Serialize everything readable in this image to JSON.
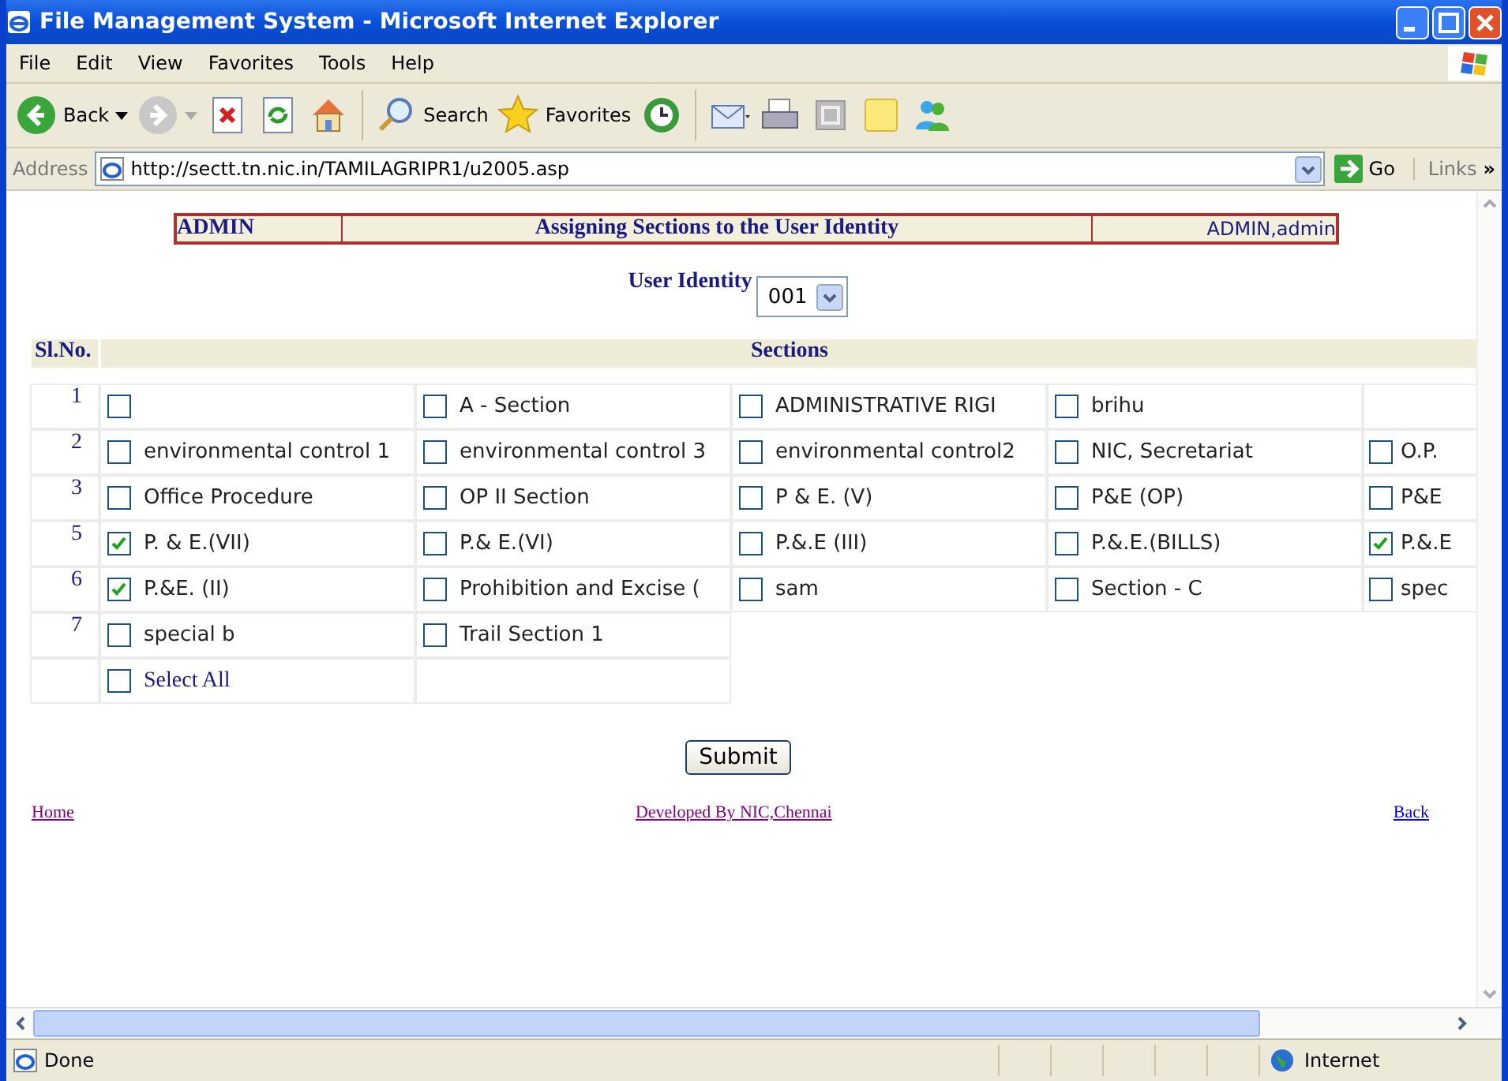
{
  "window": {
    "title": "File Management System - Microsoft Internet Explorer"
  },
  "menu": [
    "File",
    "Edit",
    "View",
    "Favorites",
    "Tools",
    "Help"
  ],
  "toolbar": [
    {
      "kind": "back",
      "label": "Back"
    },
    {
      "kind": "forward"
    },
    {
      "kind": "stop"
    },
    {
      "kind": "refresh"
    },
    {
      "kind": "home"
    },
    {
      "kind": "search",
      "label": "Search"
    },
    {
      "kind": "favorites",
      "label": "Favorites"
    },
    {
      "kind": "history"
    },
    {
      "kind": "mail"
    },
    {
      "kind": "print"
    },
    {
      "kind": "edit"
    },
    {
      "kind": "note"
    },
    {
      "kind": "messenger"
    }
  ],
  "address_bar": {
    "label": "Address",
    "url": "http://sectt.tn.nic.in/TAMILAGRIPR1/u2005.asp",
    "go": "Go",
    "links": "Links",
    "more": "»"
  },
  "header": {
    "left": "ADMIN",
    "title": "Assigning Sections to the User Identity",
    "right": "ADMIN,admin"
  },
  "user_identity": {
    "label": "User Identity",
    "value": "001"
  },
  "table": {
    "heading_bar": {
      "number_heading": "Sl.No.",
      "sections_heading": "Sections"
    },
    "rows": [
      {
        "number": "1",
        "cells": [
          {
            "kind": "check",
            "checked": false
          },
          {
            "kind": "check",
            "label": "A - Section",
            "checked": false
          },
          {
            "kind": "check",
            "label": "ADMINISTRATIVE RIGI",
            "checked": false
          },
          {
            "kind": "check",
            "label": "brihu",
            "checked": false
          },
          {
            "kind": "empty"
          }
        ]
      },
      {
        "number": "2",
        "cells": [
          {
            "kind": "check",
            "label": "environmental control 1",
            "checked": false
          },
          {
            "kind": "check",
            "label": "environmental control 3",
            "checked": false
          },
          {
            "kind": "check",
            "label": "environmental control2",
            "checked": false
          },
          {
            "kind": "check",
            "label": "NIC, Secretariat",
            "checked": false
          },
          {
            "kind": "check",
            "label": "O.P.",
            "checked": false
          }
        ]
      },
      {
        "number": "3",
        "cells": [
          {
            "kind": "check",
            "label": "Office Procedure",
            "checked": false
          },
          {
            "kind": "check",
            "label": "OP II Section",
            "checked": false
          },
          {
            "kind": "check",
            "label": "P & E. (V)",
            "checked": false
          },
          {
            "kind": "check",
            "label": "P&E (OP)",
            "checked": false
          },
          {
            "kind": "check",
            "label": "P&E",
            "checked": false
          }
        ]
      },
      {
        "number": "5",
        "cells": [
          {
            "kind": "check",
            "label": "P. & E.(VII)",
            "checked": true
          },
          {
            "kind": "check",
            "label": "P.& E.(VI)",
            "checked": false
          },
          {
            "kind": "check",
            "label": "P.&.E (III)",
            "checked": false
          },
          {
            "kind": "check",
            "label": "P.&.E.(BILLS)",
            "checked": false
          },
          {
            "kind": "check",
            "label": "P.&.E",
            "checked": true
          }
        ]
      },
      {
        "number": "6",
        "cells": [
          {
            "kind": "check",
            "label": "P.&E. (II)",
            "checked": true
          },
          {
            "kind": "check",
            "label": "Prohibition and Excise (",
            "checked": false
          },
          {
            "kind": "check",
            "label": "sam",
            "checked": false
          },
          {
            "kind": "check",
            "label": "Section - C",
            "checked": false
          },
          {
            "kind": "check",
            "label": "spec",
            "checked": false
          }
        ]
      },
      {
        "number": "7",
        "cells": [
          {
            "kind": "check",
            "label": "special b",
            "checked": false
          },
          {
            "kind": "check",
            "label": "Trail Section 1",
            "checked": false
          }
        ]
      }
    ],
    "select_all": {
      "label": "Select All",
      "checked": false
    }
  },
  "submit": "Submit",
  "footer": {
    "home": "Home",
    "credit": "Developed By NIC,Chennai",
    "back": "Back"
  },
  "status_bar": {
    "text": "Done",
    "zone": "Internet"
  }
}
